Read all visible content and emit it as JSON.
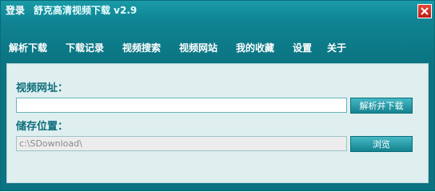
{
  "titlebar": {
    "login_label": "登录",
    "app_title": "舒克高清视频下载 v2.9",
    "close_icon": "close-icon",
    "close_color": "#c8281d"
  },
  "nav": {
    "items": [
      "解析下载",
      "下载记录",
      "视频搜索",
      "视频网站",
      "我的收藏",
      "设置",
      "关于"
    ]
  },
  "form": {
    "url_label": "视频网址：",
    "url_value": "",
    "download_button": "解析并下载",
    "save_label": "储存位置：",
    "save_path": "c:\\SDownload\\",
    "browse_button": "浏览"
  },
  "colors": {
    "header": "#0f8392",
    "panel": "#dfefef",
    "label": "#0d6e7b"
  }
}
